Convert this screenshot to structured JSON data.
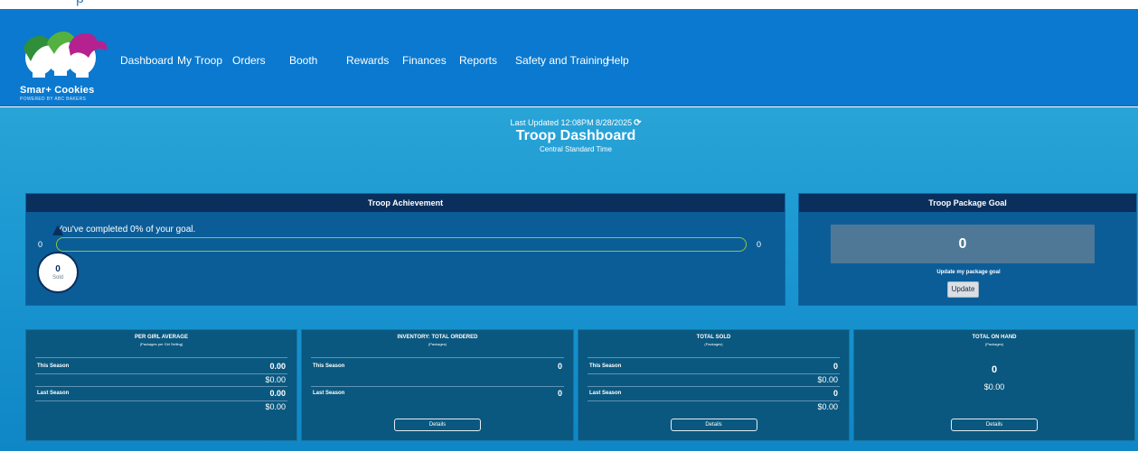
{
  "top_fragment": "p",
  "logo": {
    "brand": "Smar+ Cookies",
    "tagline": "POWERED BY ABC BAKERS"
  },
  "nav": {
    "items": [
      {
        "label": "Dashboard"
      },
      {
        "label": "My Troop"
      },
      {
        "label": "Orders"
      },
      {
        "label": "Booth"
      },
      {
        "label": "Rewards"
      },
      {
        "label": "Finances"
      },
      {
        "label": "Reports"
      },
      {
        "label": "Safety and Training"
      },
      {
        "label": "Help"
      }
    ]
  },
  "header": {
    "last_updated": "Last Updated 12:08PM 8/28/2025",
    "title": "Troop Dashboard",
    "timezone": "Central Standard Time"
  },
  "achievement": {
    "title": "Troop Achievement",
    "message": "You've completed 0% of your goal.",
    "min": "0",
    "max": "0",
    "progress_fraction": 0,
    "sold_value": "0",
    "sold_label": "Sold"
  },
  "goal": {
    "title": "Troop Package Goal",
    "value": "0",
    "update_text": "Update my package goal",
    "button": "Update"
  },
  "cards": {
    "per_girl": {
      "title": "PER GIRL AVERAGE",
      "subtitle": "(Packages per Girl Selling)",
      "this_season_label": "This Season",
      "this_season_value": "0.00",
      "this_season_amount": "$0.00",
      "last_season_label": "Last Season",
      "last_season_value": "0.00",
      "last_season_amount": "$0.00"
    },
    "inventory": {
      "title": "INVENTORY: TOTAL ORDERED",
      "subtitle": "(Packages)",
      "this_season_label": "This Season",
      "this_season_value": "0",
      "last_season_label": "Last Season",
      "last_season_value": "0",
      "details": "Details"
    },
    "total_sold": {
      "title": "TOTAL SOLD",
      "subtitle": "(Packages)",
      "this_season_label": "This Season",
      "this_season_value": "0",
      "this_season_amount": "$0.00",
      "last_season_label": "Last Season",
      "last_season_value": "0",
      "last_season_amount": "$0.00",
      "details": "Details"
    },
    "on_hand": {
      "title": "TOTAL ON HAND",
      "subtitle": "(Packages)",
      "value": "0",
      "amount": "$0.00",
      "details": "Details"
    }
  },
  "colors": {
    "header_bg": "#0a79cf",
    "panel_header": "#0a2f5c",
    "progress_bar": "#8ec63f"
  }
}
